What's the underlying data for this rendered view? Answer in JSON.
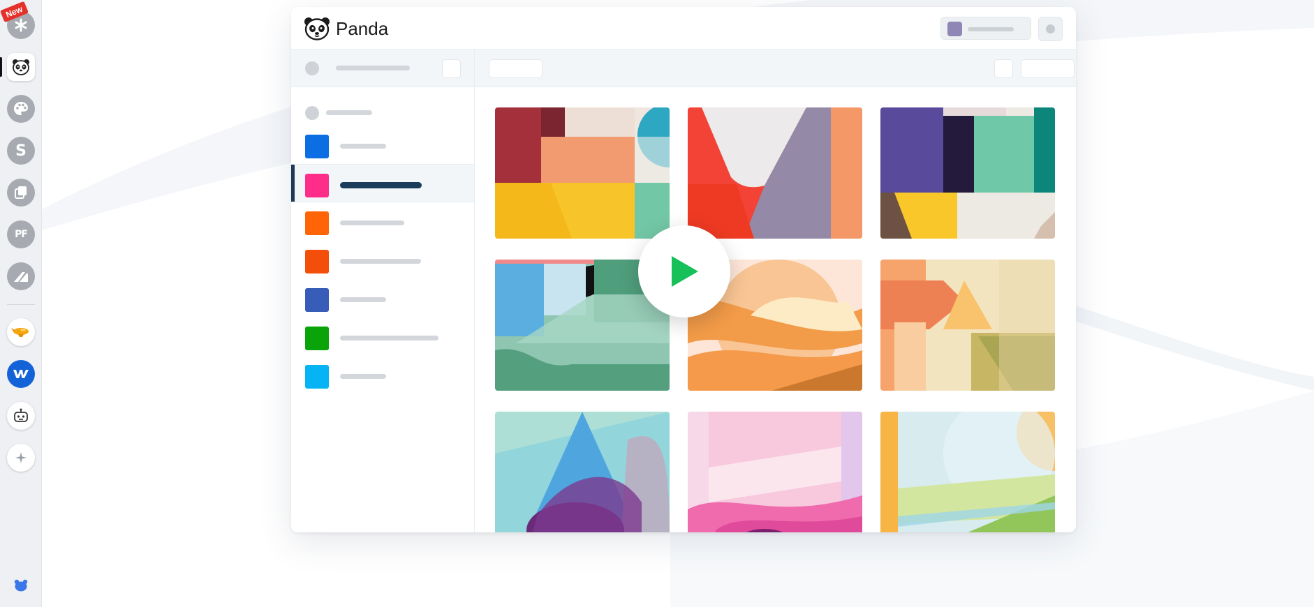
{
  "app": {
    "brand_name": "Panda",
    "accent_color": "#1b3b5a"
  },
  "rail": {
    "new_badge": "New",
    "items": [
      {
        "icon": "asterisk-icon"
      },
      {
        "icon": "panda-icon",
        "active": true
      },
      {
        "icon": "palette-icon"
      },
      {
        "icon": "letter-s-icon",
        "letter": "S"
      },
      {
        "icon": "copy-icon"
      },
      {
        "icon": "pf-icon",
        "letter": "PF"
      },
      {
        "icon": "ramp-icon"
      },
      {
        "icon": "airship-icon"
      },
      {
        "icon": "webflow-icon"
      },
      {
        "icon": "robot-icon"
      },
      {
        "icon": "sparkle-icon"
      }
    ],
    "bottom_icon": "bear-icon"
  },
  "categories": [
    {
      "color": "#0b6fe3"
    },
    {
      "color": "#ff2d8a",
      "active": true
    },
    {
      "color": "#ff6407"
    },
    {
      "color": "#f44e0b"
    },
    {
      "color": "#375db8"
    },
    {
      "color": "#0aa30a"
    },
    {
      "color": "#06b4f5"
    }
  ],
  "play_button": {
    "icon": "play-icon",
    "color": "#18c05a"
  }
}
